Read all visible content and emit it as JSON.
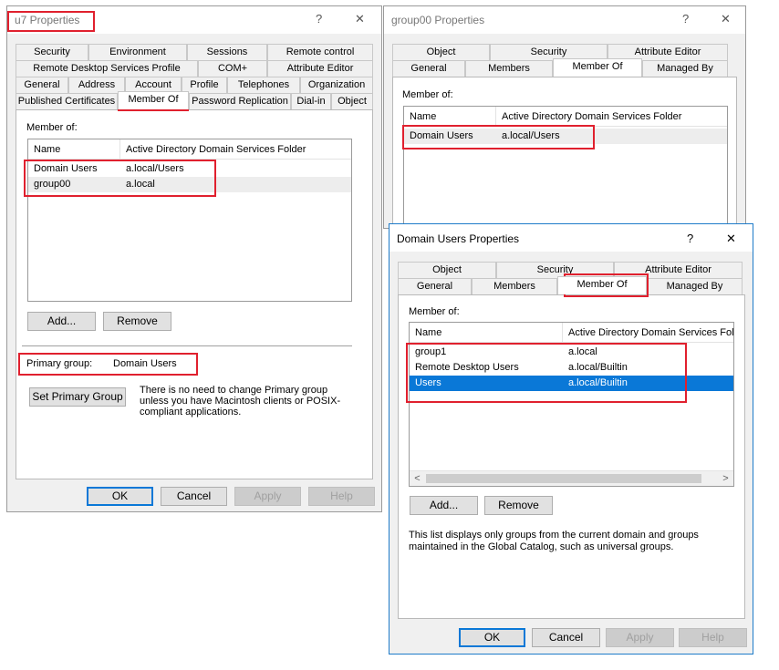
{
  "u7": {
    "title": "u7 Properties",
    "help": "?",
    "close": "✕",
    "tabs_row1": [
      "Security",
      "Environment",
      "Sessions",
      "Remote control"
    ],
    "tabs_row2": [
      "Remote Desktop Services Profile",
      "COM+",
      "Attribute Editor"
    ],
    "tabs_row3": [
      "General",
      "Address",
      "Account",
      "Profile",
      "Telephones",
      "Organization"
    ],
    "tabs_row4": [
      "Published Certificates",
      "Member Of",
      "Password Replication",
      "Dial-in",
      "Object"
    ],
    "member_of_label": "Member of:",
    "columns": [
      "Name",
      "Active Directory Domain Services Folder"
    ],
    "rows": [
      {
        "name": "Domain Users",
        "folder": "a.local/Users"
      },
      {
        "name": "group00",
        "folder": "a.local"
      }
    ],
    "add_label": "Add...",
    "remove_label": "Remove",
    "primary_group_label": "Primary group:",
    "primary_group_value": "Domain Users",
    "set_primary_label": "Set Primary Group",
    "note": "There is no need to change Primary group unless you have Macintosh clients or POSIX-compliant applications.",
    "ok": "OK",
    "cancel": "Cancel",
    "apply": "Apply",
    "help_btn": "Help"
  },
  "group00": {
    "title": "group00 Properties",
    "help": "?",
    "close": "✕",
    "tabs_row1": [
      "Object",
      "Security",
      "Attribute Editor"
    ],
    "tabs_row2": [
      "General",
      "Members",
      "Member Of",
      "Managed By"
    ],
    "member_of_label": "Member of:",
    "columns": [
      "Name",
      "Active Directory Domain Services Folder"
    ],
    "rows": [
      {
        "name": "Domain Users",
        "folder": "a.local/Users"
      }
    ]
  },
  "domain_users": {
    "title": "Domain Users Properties",
    "help": "?",
    "close": "✕",
    "tabs_row1": [
      "Object",
      "Security",
      "Attribute Editor"
    ],
    "tabs_row2": [
      "General",
      "Members",
      "Member Of",
      "Managed By"
    ],
    "member_of_label": "Member of:",
    "columns": [
      "Name",
      "Active Directory Domain Services Fold"
    ],
    "rows": [
      {
        "name": "group1",
        "folder": "a.local"
      },
      {
        "name": "Remote Desktop Users",
        "folder": "a.local/Builtin"
      },
      {
        "name": "Users",
        "folder": "a.local/Builtin"
      }
    ],
    "scroll_left": "<",
    "scroll_right": ">",
    "add_label": "Add...",
    "remove_label": "Remove",
    "note": "This list displays only groups from the current domain and groups maintained in the Global Catalog, such as universal groups.",
    "ok": "OK",
    "cancel": "Cancel",
    "apply": "Apply",
    "help_btn": "Help"
  },
  "colors": {
    "selection": "#0a78d7",
    "highlight_box": "#e0202e",
    "active_border": "#1e7bc9"
  }
}
